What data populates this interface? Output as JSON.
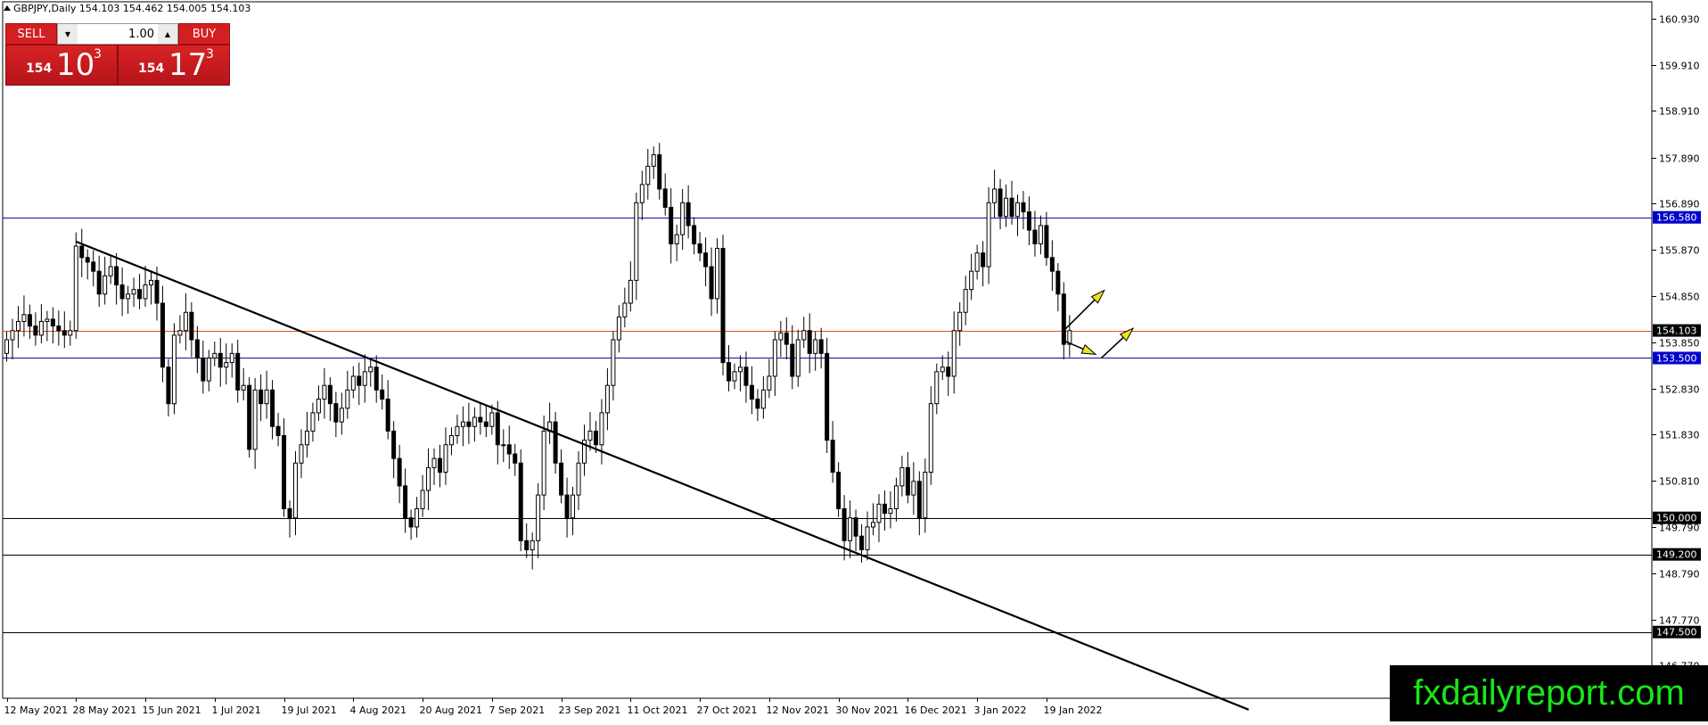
{
  "header": {
    "symbol_info": "GBPJPY,Daily  154.103 154.462 154.005 154.103"
  },
  "trade_panel": {
    "sell_label": "SELL",
    "buy_label": "BUY",
    "lot_value": "1.00",
    "sell_quote": {
      "big_figure": "154",
      "pips": "10",
      "fraction": "3"
    },
    "buy_quote": {
      "big_figure": "154",
      "pips": "17",
      "fraction": "3"
    }
  },
  "watermark": "fxdailyreport.com",
  "colors": {
    "bid_line": "#e0501e",
    "blue_level": "#1010a0",
    "black_level": "#000000",
    "label_blue_bg": "#0000cc",
    "label_black_bg": "#000000",
    "arrow_fill": "#f0e020",
    "watermark_text": "#19e61a"
  },
  "chart_data": {
    "type": "candlestick",
    "symbol": "GBPJPY",
    "timeframe": "Daily",
    "ylim": [
      146.05,
      161.3
    ],
    "price_ticks": [
      "160.930",
      "159.910",
      "158.910",
      "157.890",
      "156.890",
      "155.870",
      "154.850",
      "153.850",
      "152.830",
      "151.830",
      "150.810",
      "149.790",
      "148.790",
      "147.770",
      "146.770"
    ],
    "date_labels": [
      {
        "label": "12 May 2021",
        "bar": 0
      },
      {
        "label": "28 May 2021",
        "bar": 12
      },
      {
        "label": "15 Jun 2021",
        "bar": 24
      },
      {
        "label": "1 Jul 2021",
        "bar": 36
      },
      {
        "label": "19 Jul 2021",
        "bar": 48
      },
      {
        "label": "4 Aug 2021",
        "bar": 60
      },
      {
        "label": "20 Aug 2021",
        "bar": 72
      },
      {
        "label": "7 Sep 2021",
        "bar": 84
      },
      {
        "label": "23 Sep 2021",
        "bar": 96
      },
      {
        "label": "11 Oct 2021",
        "bar": 108
      },
      {
        "label": "27 Oct 2021",
        "bar": 120
      },
      {
        "label": "12 Nov 2021",
        "bar": 132
      },
      {
        "label": "30 Nov 2021",
        "bar": 144
      },
      {
        "label": "16 Dec 2021",
        "bar": 156
      },
      {
        "label": "3 Jan 2022",
        "bar": 168
      },
      {
        "label": "19 Jan 2022",
        "bar": 180
      }
    ],
    "closes": [
      153.9,
      154.1,
      154.3,
      154.45,
      154.2,
      154.0,
      154.3,
      154.35,
      154.2,
      154.1,
      154.0,
      154.1,
      155.95,
      155.7,
      155.6,
      155.4,
      154.9,
      155.3,
      155.5,
      155.1,
      154.8,
      154.9,
      155.0,
      154.8,
      155.1,
      155.2,
      154.7,
      153.3,
      152.5,
      154.0,
      154.1,
      154.5,
      153.9,
      153.5,
      153.0,
      153.5,
      153.6,
      153.3,
      153.4,
      153.6,
      152.8,
      152.9,
      151.5,
      152.8,
      152.5,
      152.8,
      152.0,
      151.8,
      150.2,
      150.0,
      151.2,
      151.6,
      151.9,
      152.3,
      152.6,
      152.9,
      152.5,
      152.1,
      152.4,
      152.8,
      153.1,
      152.9,
      153.2,
      153.3,
      152.8,
      152.6,
      151.9,
      151.3,
      150.7,
      150.0,
      149.8,
      150.2,
      150.6,
      151.1,
      151.3,
      151.0,
      151.6,
      151.8,
      152.0,
      152.1,
      152.0,
      152.2,
      152.1,
      152.0,
      152.3,
      151.6,
      151.6,
      151.4,
      151.2,
      149.5,
      149.3,
      149.5,
      150.5,
      151.9,
      152.1,
      151.2,
      150.5,
      150.0,
      150.5,
      151.2,
      151.7,
      151.9,
      151.6,
      152.3,
      152.9,
      153.9,
      154.4,
      154.7,
      155.2,
      156.9,
      157.3,
      157.7,
      157.95,
      157.2,
      156.8,
      156.0,
      156.2,
      156.9,
      156.4,
      156.0,
      155.8,
      155.5,
      154.8,
      155.9,
      153.4,
      153.0,
      153.2,
      153.3,
      152.9,
      152.6,
      152.4,
      152.8,
      153.1,
      153.9,
      154.05,
      153.8,
      153.1,
      153.9,
      154.1,
      153.6,
      153.9,
      153.6,
      151.7,
      151.0,
      150.2,
      149.5,
      150.0,
      149.6,
      149.3,
      149.8,
      149.9,
      150.3,
      150.1,
      150.2,
      150.7,
      151.1,
      150.5,
      150.8,
      150.0,
      151.0,
      152.5,
      153.2,
      153.3,
      153.1,
      154.1,
      154.5,
      155.0,
      155.4,
      155.8,
      155.5,
      156.9,
      157.2,
      156.6,
      157.0,
      156.6,
      156.9,
      156.7,
      156.3,
      156.0,
      156.4,
      155.7,
      155.4,
      154.9,
      153.8,
      154.1
    ]
  },
  "levels": [
    {
      "name": "resistance",
      "price": 156.58,
      "label": "156.580",
      "style": "blue"
    },
    {
      "name": "support",
      "price": 153.5,
      "label": "153.500",
      "style": "blue"
    },
    {
      "name": "level-150",
      "price": 150.0,
      "label": "150.000",
      "style": "black"
    },
    {
      "name": "level-149-2",
      "price": 149.2,
      "label": "149.200",
      "style": "black"
    },
    {
      "name": "level-147-5",
      "price": 147.5,
      "label": "147.500",
      "style": "black"
    },
    {
      "name": "bid",
      "price": 154.103,
      "label": "154.103",
      "style": "bid"
    }
  ],
  "trendline": {
    "start": {
      "bar": 12,
      "price": 156.05
    },
    "end": {
      "bar": 215,
      "price": 145.8
    }
  },
  "arrows": [
    {
      "from_bar": 183,
      "from_price": 154.1,
      "to_bar": 190,
      "to_price": 154.98
    },
    {
      "from_bar": 183,
      "from_price": 153.88,
      "to_bar": 188.5,
      "to_price": 153.58
    },
    {
      "from_bar": 189.5,
      "from_price": 153.5,
      "to_bar": 195,
      "to_price": 154.15
    }
  ]
}
